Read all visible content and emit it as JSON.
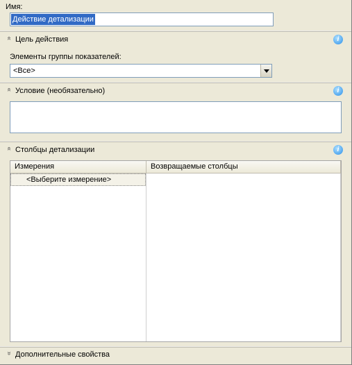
{
  "name_section": {
    "label": "Имя:",
    "value": "Действие детализации"
  },
  "sections": {
    "target": {
      "title": "Цель действия",
      "elements_label": "Элементы группы показателей:",
      "dropdown_value": "<Все>"
    },
    "condition": {
      "title": "Условие (необязательно)",
      "value": ""
    },
    "columns": {
      "title": "Столбцы детализации",
      "header_dimensions": "Измерения",
      "header_return_cols": "Возвращаемые столбцы",
      "new_row_placeholder": "<Выберите измерение>"
    },
    "advanced": {
      "title": "Дополнительные свойства"
    }
  },
  "icons": {
    "info": "i",
    "expand": "«",
    "collapse": "»"
  }
}
